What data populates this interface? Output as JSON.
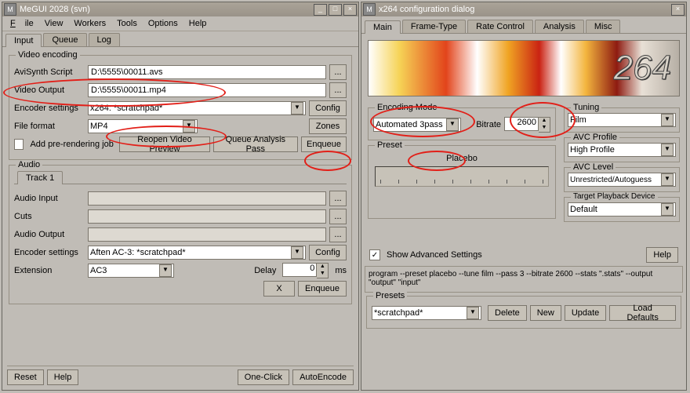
{
  "left": {
    "title": "MeGUI 2028 (svn)",
    "menu": {
      "file": "File",
      "view": "View",
      "workers": "Workers",
      "tools": "Tools",
      "options": "Options",
      "help": "Help"
    },
    "tabs": {
      "input": "Input",
      "queue": "Queue",
      "log": "Log"
    },
    "video": {
      "legend": "Video encoding",
      "script_lbl": "AviSynth Script",
      "script_val": "D:\\5555\\00011.avs",
      "out_lbl": "Video Output",
      "out_val": "D:\\5555\\00011.mp4",
      "enc_lbl": "Encoder settings",
      "enc_val": "x264: *scratchpad*",
      "config": "Config",
      "fmt_lbl": "File format",
      "fmt_val": "MP4",
      "zones": "Zones",
      "addpre": "Add pre-rendering job",
      "reopen": "Reopen Video Preview",
      "qap": "Queue Analysis Pass",
      "enq": "Enqueue"
    },
    "audio": {
      "legend": "Audio",
      "track": "Track 1",
      "in_lbl": "Audio Input",
      "cuts_lbl": "Cuts",
      "out_lbl": "Audio Output",
      "enc_lbl": "Encoder settings",
      "enc_val": "Aften AC-3: *scratchpad*",
      "config": "Config",
      "ext_lbl": "Extension",
      "ext_val": "AC3",
      "delay_lbl": "Delay",
      "delay_val": "0",
      "ms": "ms",
      "x": "X",
      "enq": "Enqueue"
    },
    "footer": {
      "reset": "Reset",
      "help": "Help",
      "oneclick": "One-Click",
      "auto": "AutoEncode"
    },
    "browse": "..."
  },
  "right": {
    "title": "x264 configuration dialog",
    "tabs": {
      "main": "Main",
      "frame": "Frame-Type",
      "rate": "Rate Control",
      "analysis": "Analysis",
      "misc": "Misc"
    },
    "logo": "264",
    "encmode": {
      "legend": "Encoding Mode",
      "val": "Automated 3pass",
      "bitrate_lbl": "Bitrate",
      "bitrate_val": "2600"
    },
    "preset": {
      "legend": "Preset",
      "name": "Placebo"
    },
    "tuning": {
      "legend": "Tuning",
      "val": "Film"
    },
    "avcp": {
      "legend": "AVC Profile",
      "val": "High Profile"
    },
    "avcl": {
      "legend": "AVC Level",
      "val": "Unrestricted/Autoguess"
    },
    "target": {
      "legend": "Target Playback Device",
      "val": "Default"
    },
    "showadv": "Show Advanced Settings",
    "help": "Help",
    "cmd": "program --preset placebo --tune film --pass 3 --bitrate 2600 --stats \".stats\" --output \"output\" \"input\"",
    "presets": {
      "legend": "Presets",
      "val": "*scratchpad*",
      "del": "Delete",
      "new": "New",
      "upd": "Update",
      "load": "Load Defaults"
    }
  }
}
